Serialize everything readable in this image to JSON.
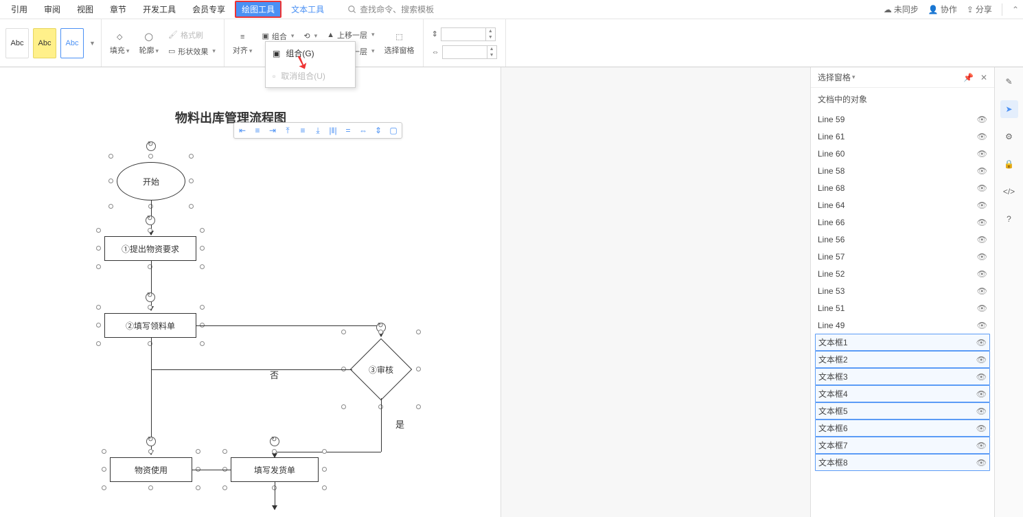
{
  "menu": {
    "tabs": [
      "引用",
      "审阅",
      "视图",
      "章节",
      "开发工具",
      "会员专享"
    ],
    "active": "绘图工具",
    "text_tool": "文本工具",
    "search_placeholder": "查找命令、搜索模板"
  },
  "topright": {
    "sync": "未同步",
    "collab": "协作",
    "share": "分享"
  },
  "ribbon": {
    "abc": "Abc",
    "fill": "填充",
    "outline": "轮廓",
    "format_painter": "格式刷",
    "shape_effect": "形状效果",
    "align": "对齐",
    "group": "组合",
    "up_layer": "上移一层",
    "down_layer": "下移一层",
    "sel_pane": "选择窗格"
  },
  "dropdown": {
    "open": "组合",
    "group": "组合(G)",
    "ungroup": "取消组合(U)"
  },
  "doc": {
    "title": "物料出库管理流程图",
    "start": "开始",
    "step1": "①提出物资要求",
    "step2": "②填写领料单",
    "step3": "③审核",
    "no": "否",
    "yes": "是",
    "use": "物资使用",
    "write_ship": "填写发货单"
  },
  "selpane": {
    "title": "选择窗格",
    "subtitle": "文档中的对象",
    "items": [
      {
        "name": "Line 59",
        "sel": false
      },
      {
        "name": "Line 61",
        "sel": false
      },
      {
        "name": "Line 60",
        "sel": false
      },
      {
        "name": "Line 58",
        "sel": false
      },
      {
        "name": "Line 68",
        "sel": false
      },
      {
        "name": "Line 64",
        "sel": false
      },
      {
        "name": "Line 66",
        "sel": false
      },
      {
        "name": "Line 56",
        "sel": false
      },
      {
        "name": "Line 57",
        "sel": false
      },
      {
        "name": "Line 52",
        "sel": false
      },
      {
        "name": "Line 53",
        "sel": false
      },
      {
        "name": "Line 51",
        "sel": false
      },
      {
        "name": "Line 49",
        "sel": false
      },
      {
        "name": "文本框1",
        "sel": true
      },
      {
        "name": "文本框2",
        "sel": true
      },
      {
        "name": "文本框3",
        "sel": true
      },
      {
        "name": "文本框4",
        "sel": true
      },
      {
        "name": "文本框5",
        "sel": true
      },
      {
        "name": "文本框6",
        "sel": true
      },
      {
        "name": "文本框7",
        "sel": true
      },
      {
        "name": "文本框8",
        "sel": true
      }
    ]
  }
}
